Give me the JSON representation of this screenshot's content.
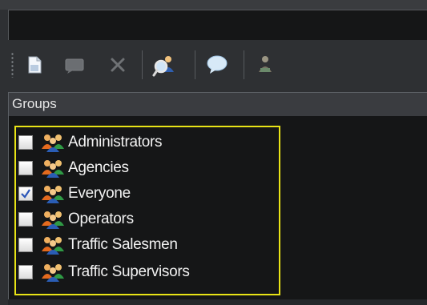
{
  "toolbar": {
    "buttons": [
      {
        "name": "new-document-icon"
      },
      {
        "name": "edit-icon"
      },
      {
        "name": "delete-icon"
      },
      {
        "name": "search-users-icon"
      },
      {
        "name": "message-icon"
      },
      {
        "name": "user-properties-icon"
      }
    ]
  },
  "groups": {
    "header": "Groups",
    "items": [
      {
        "label": "Administrators",
        "checked": false
      },
      {
        "label": "Agencies",
        "checked": false
      },
      {
        "label": "Everyone",
        "checked": true
      },
      {
        "label": "Operators",
        "checked": false
      },
      {
        "label": "Traffic Salesmen",
        "checked": false
      },
      {
        "label": "Traffic Supervisors",
        "checked": false
      }
    ]
  },
  "colors": {
    "highlight_border": "#e8e316",
    "panel_bg": "#151617",
    "window_bg": "#2e3033"
  }
}
